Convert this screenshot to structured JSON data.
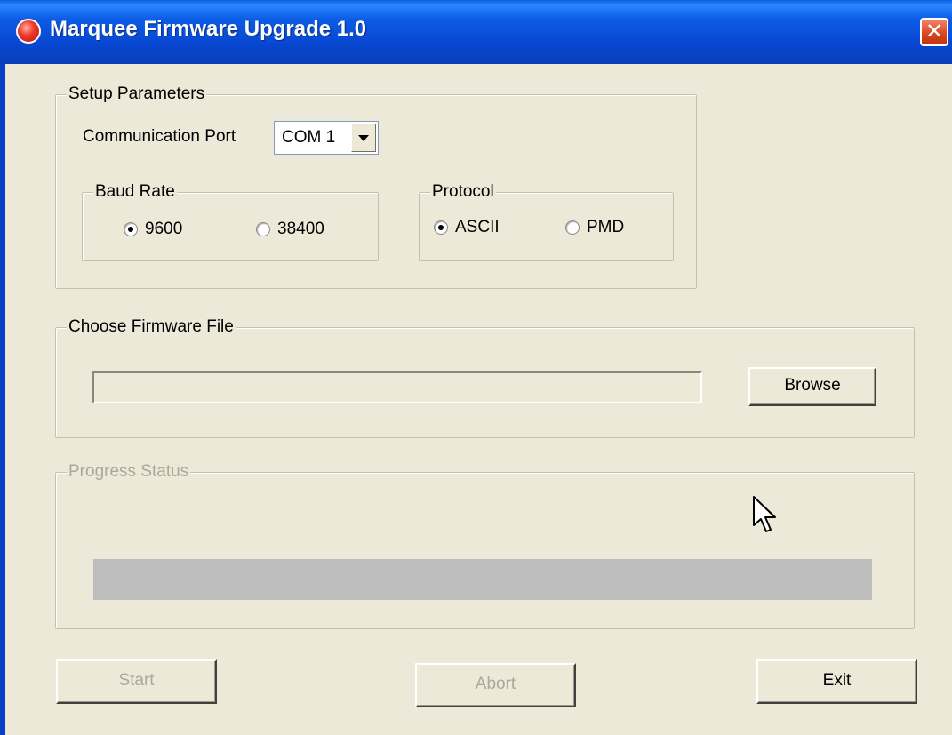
{
  "window": {
    "title": "Marquee Firmware Upgrade 1.0",
    "close_glyph": "✕"
  },
  "setup": {
    "label": "Setup Parameters",
    "port_label": "Communication Port",
    "port_value": "COM 1",
    "baud": {
      "label": "Baud Rate",
      "options": [
        {
          "label": "9600",
          "checked": true
        },
        {
          "label": "38400",
          "checked": false
        }
      ]
    },
    "protocol": {
      "label": "Protocol",
      "options": [
        {
          "label": "ASCII",
          "checked": true
        },
        {
          "label": "PMD",
          "checked": false
        }
      ]
    }
  },
  "firmware": {
    "label": "Choose Firmware File",
    "file_path": "",
    "browse_label": "Browse"
  },
  "progress": {
    "label": "Progress Status",
    "value": 0
  },
  "actions": {
    "start_label": "Start",
    "abort_label": "Abort",
    "exit_label": "Exit"
  },
  "colors": {
    "titlebar": "#0846d0",
    "dialog_bg": "#ece9d8",
    "disabled_text": "#aca899",
    "progress_track": "#bdbdbd"
  },
  "icons": {
    "app": "app-logo-icon",
    "close": "close-icon",
    "dropdown": "chevron-down-icon",
    "cursor": "mouse-pointer-icon"
  }
}
